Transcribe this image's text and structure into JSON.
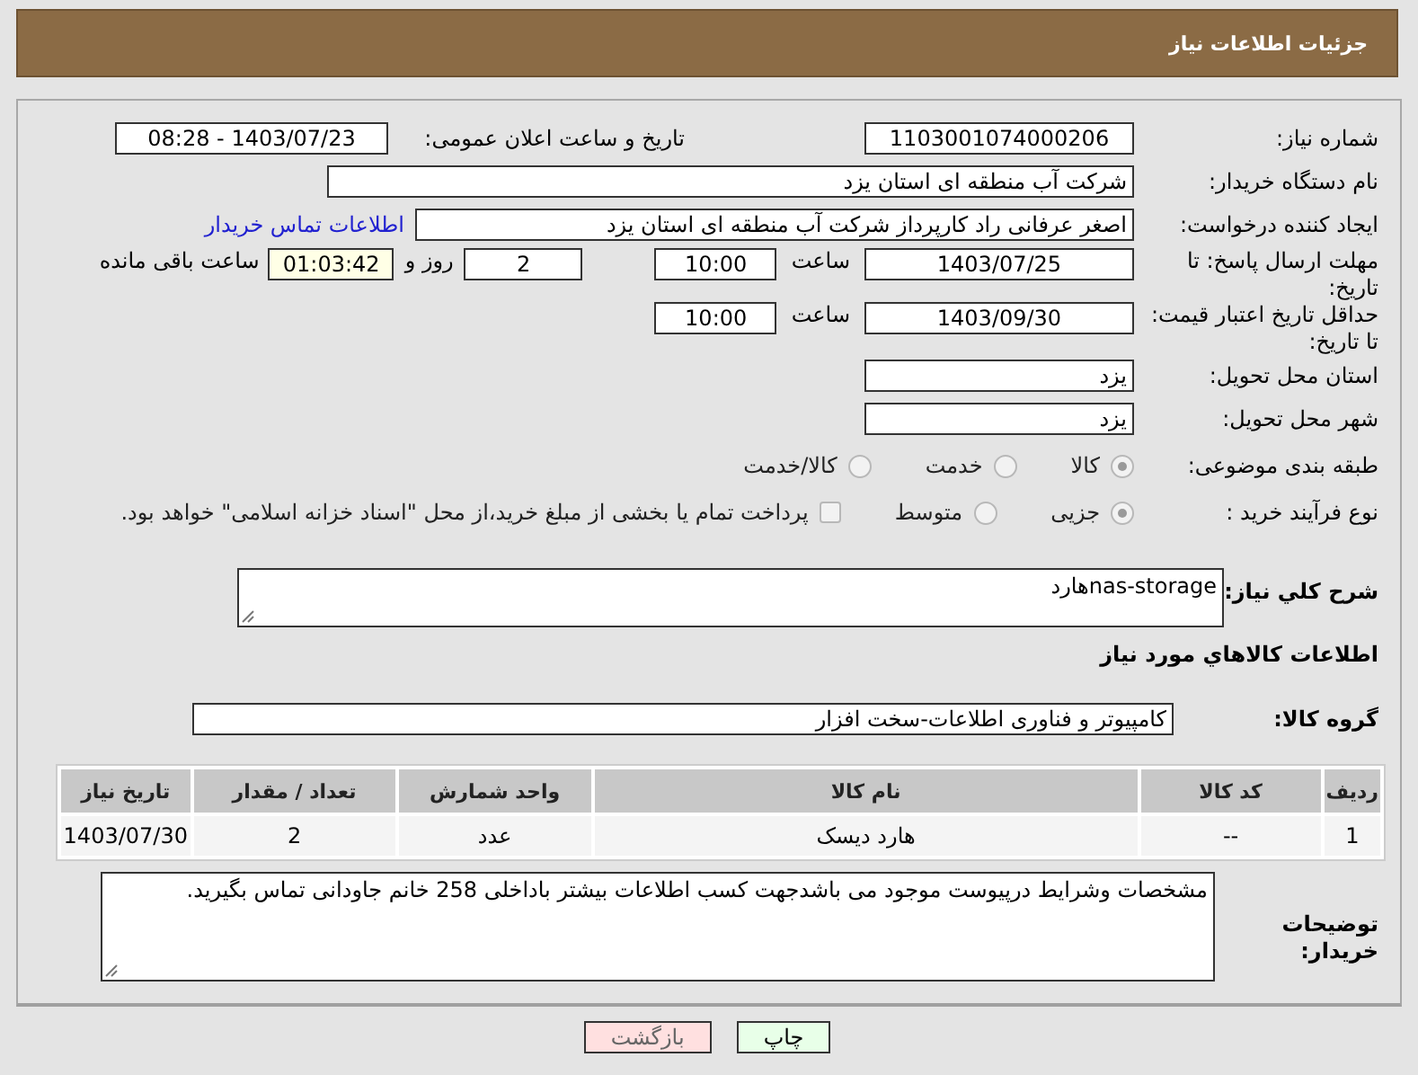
{
  "header": {
    "title": "جزئیات اطلاعات نیاز"
  },
  "need_number": {
    "label": "شماره نیاز:",
    "value": "1103001074000206"
  },
  "announce": {
    "label": "تاریخ و ساعت اعلان عمومی:",
    "value": "1403/07/23 - 08:28"
  },
  "buyer_org": {
    "label": "نام دستگاه خریدار:",
    "value": "شرکت آب منطقه ای استان یزد"
  },
  "requester": {
    "label": "ایجاد کننده درخواست:",
    "value": "اصغر عرفانی راد کارپرداز شرکت آب منطقه ای استان یزد",
    "link": "اطلاعات تماس خریدار"
  },
  "reply_deadline": {
    "label": "مهلت ارسال پاسخ: تا تاریخ:",
    "date": "1403/07/25",
    "time_label": "ساعت",
    "time": "10:00",
    "days": "2",
    "days_label": "روز و",
    "remaining": "01:03:42",
    "remaining_label": "ساعت باقی مانده"
  },
  "price_validity": {
    "label": "حداقل تاریخ اعتبار قیمت: تا تاریخ:",
    "date": "1403/09/30",
    "time_label": "ساعت",
    "time": "10:00"
  },
  "province": {
    "label": "استان محل تحویل:",
    "value": "یزد"
  },
  "city": {
    "label": "شهر محل تحویل:",
    "value": "یزد"
  },
  "category": {
    "label": "طبقه بندی موضوعی:",
    "options": [
      {
        "label": "كالا",
        "selected": true
      },
      {
        "label": "خدمت",
        "selected": false
      },
      {
        "label": "كالا/خدمت",
        "selected": false
      }
    ]
  },
  "process": {
    "label": "نوع فرآیند خرید :",
    "options": [
      {
        "label": "جزیی",
        "selected": true
      },
      {
        "label": "متوسط",
        "selected": false
      }
    ],
    "payment": {
      "label": "پرداخت تمام یا بخشی از مبلغ خرید،از محل \"اسناد خزانه اسلامی\" خواهد بود.",
      "checked": false
    }
  },
  "description": {
    "label": "شرح كلي نياز:",
    "value": "nas-storageهارد"
  },
  "items_heading": "اطلاعات كالاهاي مورد نياز",
  "goods_group": {
    "label": "گروه کالا:",
    "value": "کامپیوتر و فناوری اطلاعات-سخت افزار"
  },
  "table": {
    "columns": [
      "ردیف",
      "کد کالا",
      "نام کالا",
      "واحد شمارش",
      "تعداد / مقدار",
      "تاریخ نیاز"
    ],
    "rows": [
      [
        "1",
        "--",
        "هارد دیسک",
        "عدد",
        "2",
        "1403/07/30"
      ]
    ]
  },
  "buyer_notes": {
    "label": "توضیحات خریدار:",
    "value": "مشخصات وشرایط درپیوست موجود می باشدجهت کسب اطلاعات بیشتر باداخلی 258 خانم جاودانی تماس بگیرید."
  },
  "buttons": [
    {
      "label": "چاپ",
      "kind": "print"
    },
    {
      "label": "بازگشت",
      "kind": "back"
    }
  ]
}
